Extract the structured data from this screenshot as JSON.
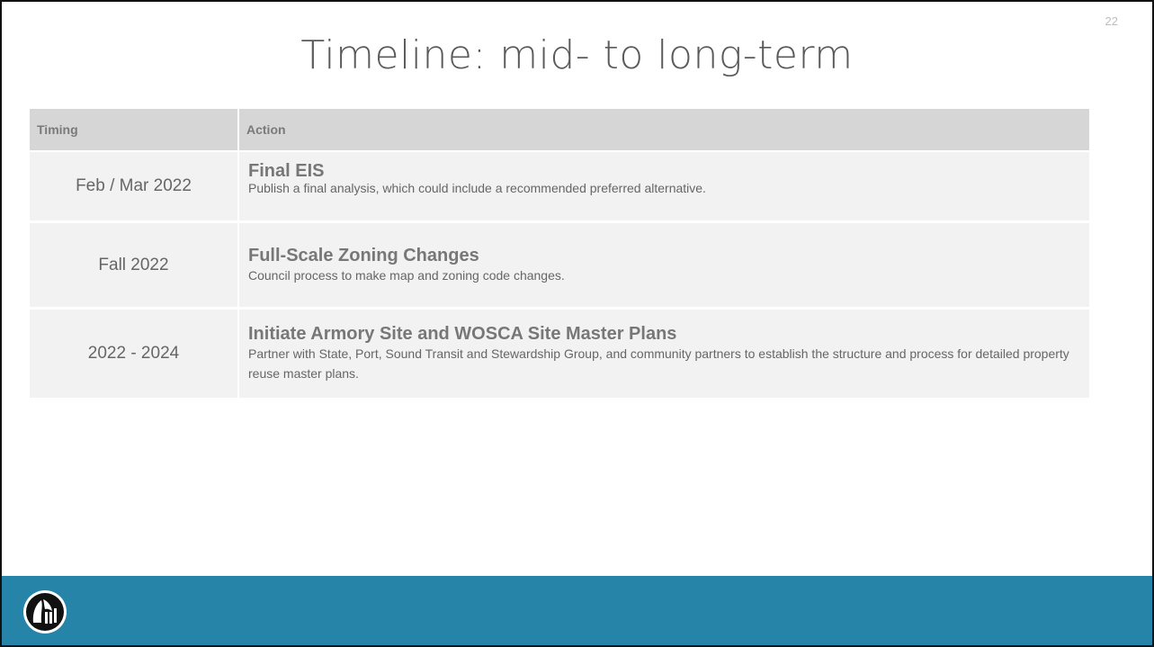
{
  "slide": {
    "page_number": "22",
    "title": "Timeline: mid- to long-term"
  },
  "table": {
    "headers": {
      "timing": "Timing",
      "action": "Action"
    },
    "rows": [
      {
        "timing": "Feb / Mar 2022",
        "title": "Final EIS",
        "description": "Publish a final analysis, which could include a recommended preferred alternative."
      },
      {
        "timing": "Fall 2022",
        "title": "Full-Scale Zoning Changes",
        "description": "Council process to make map and zoning code changes."
      },
      {
        "timing": "2022 - 2024",
        "title": "Initiate Armory Site and WOSCA Site Master Plans",
        "description": "Partner with State, Port, Sound Transit and Stewardship Group, and community partners to establish the structure and process for detailed property reuse master plans."
      }
    ]
  },
  "footer": {
    "color": "#2584a8",
    "logo_icon": "city-seal-logo-icon"
  }
}
